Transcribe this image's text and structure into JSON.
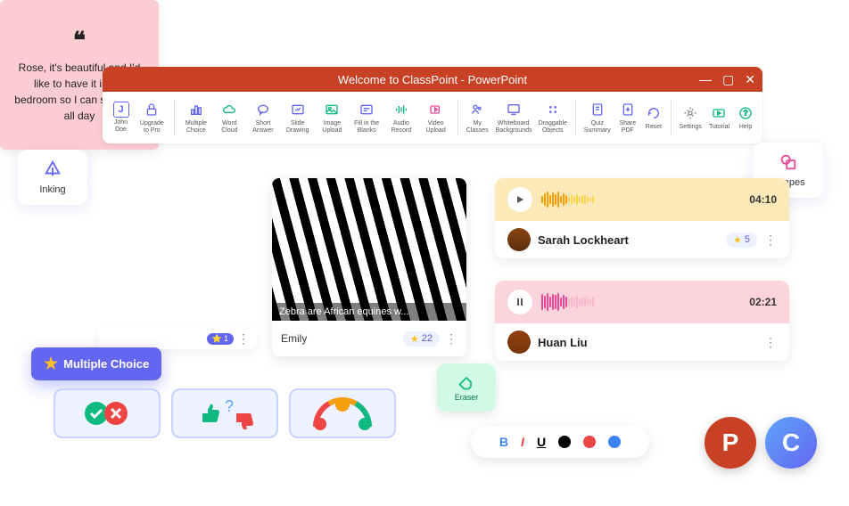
{
  "titlebar": {
    "title": "Welcome to ClassPoint - PowerPoint"
  },
  "ribbon": {
    "group1": [
      {
        "label": "John Doe",
        "icon": "J"
      },
      {
        "label": "Upgrade to Pro",
        "icon": "lock"
      }
    ],
    "group2": [
      {
        "label": "Multiple Choice",
        "icon": "bars"
      },
      {
        "label": "Word Cloud",
        "icon": "cloud"
      },
      {
        "label": "Short Answer",
        "icon": "bubble"
      },
      {
        "label": "Slide Drawing",
        "icon": "pen"
      },
      {
        "label": "Image Upload",
        "icon": "image"
      },
      {
        "label": "Fill in the Blanks",
        "icon": "fill"
      },
      {
        "label": "Audio Record",
        "icon": "wave"
      },
      {
        "label": "Video Upload",
        "icon": "video"
      }
    ],
    "group3": [
      {
        "label": "My Classes",
        "icon": "classes"
      },
      {
        "label": "Whiteboard Backgrounds",
        "icon": "whiteboard"
      },
      {
        "label": "Draggable Objects",
        "icon": "drag"
      }
    ],
    "group4": [
      {
        "label": "Quiz Summary",
        "icon": "quiz"
      },
      {
        "label": "Share PDF",
        "icon": "pdf"
      },
      {
        "label": "Reset",
        "icon": "reset"
      }
    ],
    "group5": [
      {
        "label": "Settings",
        "icon": "gear"
      },
      {
        "label": "Tutorial",
        "icon": "play"
      },
      {
        "label": "Help",
        "icon": "help"
      }
    ]
  },
  "inking": {
    "label": "Inking"
  },
  "shapes": {
    "label": "Shapes"
  },
  "quote": {
    "text": "Rose, it's beautiful and I'd like to have it in my bedroom so I can stare at it all day",
    "badge": "1"
  },
  "zebra": {
    "caption": "Zebra are African equines w...",
    "author": "Emily",
    "count": "22"
  },
  "audio1": {
    "time": "04:10",
    "user": "Sarah Lockheart",
    "stars": "5"
  },
  "audio2": {
    "time": "02:21",
    "user": "Huan Liu"
  },
  "mc": {
    "label": "Multiple Choice"
  },
  "eraser": {
    "label": "Eraser"
  },
  "format": {
    "b": "B",
    "i": "I",
    "u": "U"
  },
  "logos": {
    "p": "P",
    "c": "C"
  }
}
